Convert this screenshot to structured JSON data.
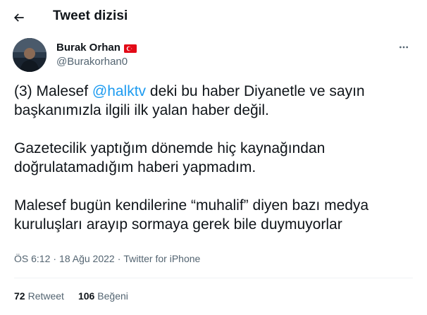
{
  "header": {
    "title": "Tweet dizisi"
  },
  "author": {
    "display_name": "Burak Orhan",
    "handle": "@Burakorhan0",
    "flag": "turkey-flag-icon"
  },
  "tweet": {
    "p1_prefix": "(3) Malesef ",
    "p1_mention": "@halktv",
    "p1_suffix": " deki bu haber Diyanetle ve sayın başkanımızla ilgili ilk yalan haber değil.",
    "p2": "Gazetecilik yaptığım dönemde hiç kaynağından doğrulatamadığım haberi yapmadım.",
    "p3": "Malesef bugün kendilerine “muhalif” diyen bazı medya kuruluşları arayıp sormaya gerek bile duymuyorlar"
  },
  "meta": {
    "time": "ÖS 6:12",
    "sep1": "·",
    "date": "18 Ağu 2022",
    "sep2": "·",
    "source": "Twitter for iPhone"
  },
  "stats": {
    "retweets_count": "72",
    "retweets_label": "Retweet",
    "likes_count": "106",
    "likes_label": "Beğeni"
  },
  "colors": {
    "link": "#1d9bf0",
    "secondary": "#536471",
    "text": "#0f1419"
  }
}
